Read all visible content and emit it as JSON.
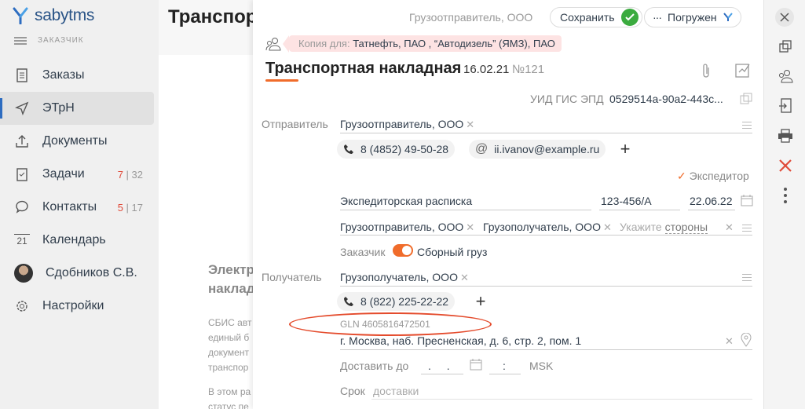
{
  "app": {
    "logo_text": "sabytms",
    "role": "ЗАКАЗЧИК"
  },
  "nav": {
    "orders": "Заказы",
    "etrn": "ЭТрН",
    "documents": "Документы",
    "tasks": "Задачи",
    "tasks_count_red": "7",
    "tasks_count_total": "32",
    "contacts": "Контакты",
    "contacts_count_red": "5",
    "contacts_count_total": "17",
    "calendar": "Календарь",
    "calendar_day": "21",
    "user": "Сдобников С.В.",
    "settings": "Настройки"
  },
  "background": {
    "title": "Транспор",
    "heading": [
      "Электр",
      "наклад"
    ],
    "text": [
      "СБИС авт",
      "единый б",
      "документ",
      "транспор"
    ],
    "text2": [
      "В этом ра",
      "статус пе"
    ]
  },
  "header": {
    "sender": "Грузоотправитель, ООО",
    "save_label": "Сохранить",
    "status_label": "Погружен",
    "copy_label": "Копия для:",
    "copy_value": "Татнефть, ПАО , “Автодизель” (ЯМЗ), ПАО"
  },
  "document": {
    "title": "Транспортная накладная",
    "date": "16.02.21",
    "number": "№121"
  },
  "form": {
    "uid_label": "УИД ГИС ЭПД",
    "uid_value": "0529514a-90a2-443c...",
    "sender_label": "Отправитель",
    "sender_value": "Грузоотправитель, ООО",
    "sender_phone": "8 (4852) 49-50-28",
    "sender_email": "ii.ivanov@example.ru",
    "forwarder_label": "Экспедитор",
    "receipt_name": "Экспедиторская расписка",
    "receipt_number": "123-456/А",
    "receipt_date": "22.06.22",
    "party1": "Грузоотправитель, ООО",
    "party2": "Грузополучатель, ООО",
    "parties_hint": "Укажите",
    "parties_link": "стороны",
    "customer_label": "Заказчик",
    "combined_label": "Сборный груз",
    "receiver_label": "Получатель",
    "receiver_value": "Грузополучатель, ООО",
    "receiver_phone": "8 (822) 225-22-22",
    "gln": "GLN 4605816472501",
    "address": "г. Москва, наб. Пресненская, д. 6, стр. 2, пом. 1",
    "deliver_label": "Доставить до",
    "date_mask": ". .",
    "time_mask": ":",
    "timezone": "MSK",
    "term_label": "Срок",
    "term_placeholder": "доставки"
  },
  "colors": {
    "accent": "#f06c2b",
    "save": "#3bab3f",
    "close": "#e04b3a",
    "brand": "#2d6cc0"
  }
}
